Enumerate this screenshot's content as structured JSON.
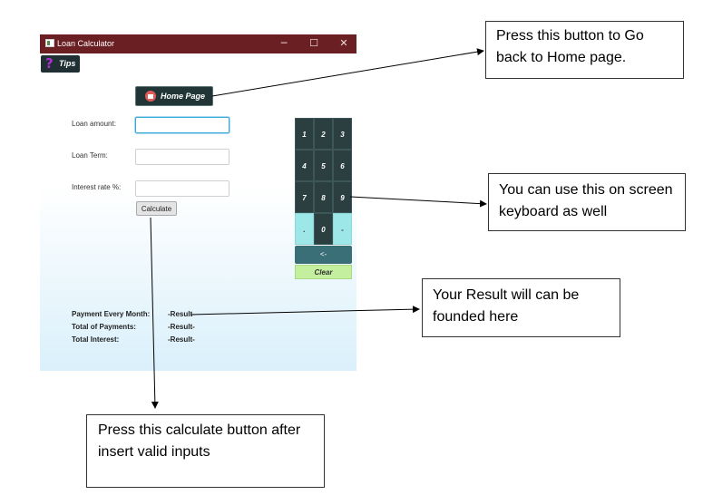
{
  "window": {
    "title": "Loan Calculator",
    "controls": {
      "minimize": "─",
      "maximize": "☐",
      "close": "✕"
    }
  },
  "toolbar": {
    "tips_label": "Tips",
    "tips_icon": "?"
  },
  "home_button": {
    "label": "Home Page"
  },
  "form": {
    "loan_amount_label": "Loan amount:",
    "loan_term_label": "Loan Term:",
    "interest_rate_label": "Interest rate %:",
    "loan_amount_value": "",
    "loan_term_value": "",
    "interest_rate_value": "",
    "calculate_label": "Calculate"
  },
  "keypad": {
    "keys": [
      "1",
      "2",
      "3",
      "4",
      "5",
      "6",
      "7",
      "8",
      "9",
      ".",
      "0",
      "-"
    ],
    "backspace": "<-",
    "clear": "Clear"
  },
  "results": {
    "monthly_label": "Payment Every Month:",
    "total_payments_label": "Total of Payments:",
    "total_interest_label": "Total Interest:",
    "monthly_value": "-Result-",
    "total_payments_value": "-Result-",
    "total_interest_value": "-Result-"
  },
  "callouts": {
    "home": "Press this button to Go back to Home page.",
    "keyboard": "You can use this on screen keyboard as well",
    "result": "Your Result will can be founded here",
    "calculate": "Press this calculate button after insert valid inputs"
  },
  "colors": {
    "titlebar": "#6a1f22",
    "key_dark": "#2b3f41",
    "key_light": "#9ee7e9",
    "clear": "#c3ef9f",
    "focus": "#3aa9d6"
  }
}
